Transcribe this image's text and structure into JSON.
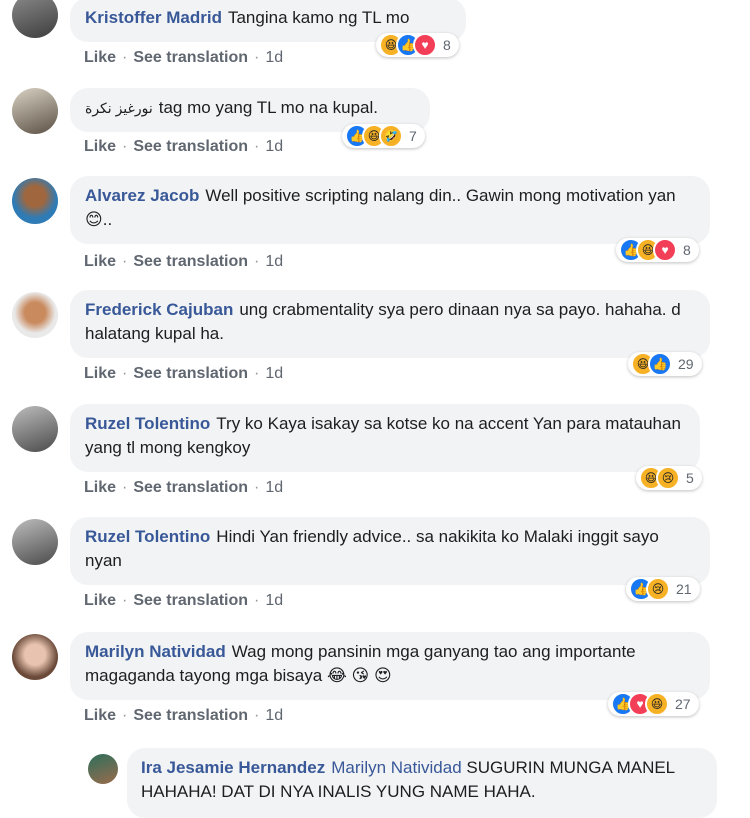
{
  "actions": {
    "like": "Like",
    "see_translation": "See translation",
    "separator": "·"
  },
  "comments": [
    {
      "author": "Kristoffer Madrid",
      "text": "Tangina kamo ng TL mo",
      "time": "1d",
      "reactions": [
        "haha-icon",
        "like-icon",
        "love-icon"
      ],
      "reaction_count": "8"
    },
    {
      "author": "نورغيز نكرة",
      "text": "tag mo yang TL mo na kupal.",
      "time": "1d",
      "reactions": [
        "like-icon",
        "haha-icon",
        "wow-icon"
      ],
      "reaction_count": "7"
    },
    {
      "author": "Alvarez Jacob",
      "text": "Well positive scripting nalang din.. Gawin mong motivation yan😊..",
      "time": "1d",
      "reactions": [
        "like-icon",
        "haha-icon",
        "love-icon"
      ],
      "reaction_count": "8"
    },
    {
      "author": "Frederick Cajuban",
      "text": "ung crabmentality sya pero dinaan nya sa payo. hahaha. d halatang kupal ha.",
      "time": "1d",
      "reactions": [
        "haha-icon",
        "like-icon"
      ],
      "reaction_count": "29"
    },
    {
      "author": "Ruzel Tolentino",
      "text": "Try ko Kaya isakay sa kotse ko na accent Yan para matauhan yang tl mong kengkoy",
      "time": "1d",
      "reactions": [
        "haha-icon",
        "sad-icon"
      ],
      "reaction_count": "5"
    },
    {
      "author": "Ruzel Tolentino",
      "text": "Hindi Yan friendly advice.. sa nakikita ko Malaki inggit sayo nyan",
      "time": "1d",
      "reactions": [
        "like-icon",
        "sad-icon"
      ],
      "reaction_count": "21"
    },
    {
      "author": "Marilyn Natividad",
      "text": "Wag mong pansinin mga ganyang tao ang importante magaganda tayong mga bisaya 😂 😘 😍",
      "time": "1d",
      "reactions": [
        "like-icon",
        "love-icon",
        "haha-icon"
      ],
      "reaction_count": "27"
    }
  ],
  "reply": {
    "author": "Ira Jesamie Hernandez",
    "mention": "Marilyn Natividad",
    "text": "SUGURIN MUNGA MANEL HAHAHA! DAT DI NYA INALIS YUNG NAME HAHA."
  },
  "colors": {
    "link": "#385898",
    "bubble": "#f2f3f5",
    "meta": "#606770",
    "like": "#1877f2",
    "love": "#f33e58",
    "haha": "#f7b125"
  }
}
